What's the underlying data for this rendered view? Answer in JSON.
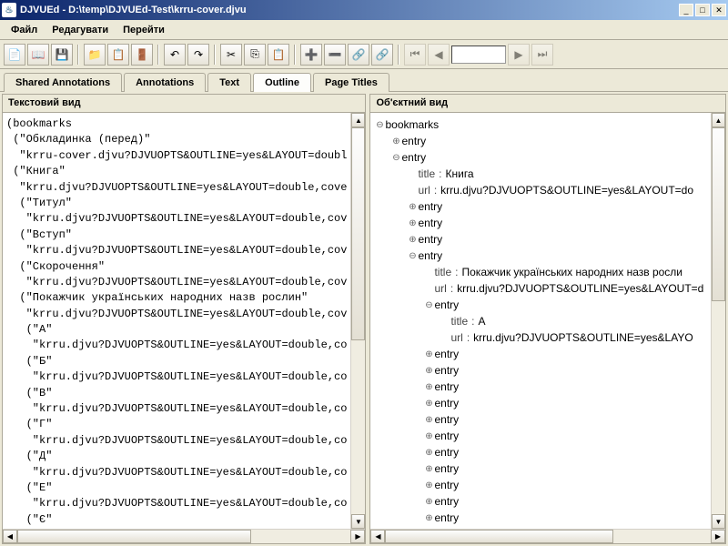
{
  "title": "DJVUEd - D:\\temp\\DJVUEd-Test\\krru-cover.djvu",
  "menu": {
    "file": "Файл",
    "edit": "Редагувати",
    "go": "Перейти"
  },
  "tabs": {
    "shared": "Shared Annotations",
    "annotations": "Annotations",
    "text": "Text",
    "outline": "Outline",
    "pagetitles": "Page Titles"
  },
  "panes": {
    "text": "Текстовий вид",
    "object": "Об'єктний вид"
  },
  "textview": "(bookmarks\n (\"Обкладинка (перед)\"\n  \"krru-cover.djvu?DJVUOPTS&OUTLINE=yes&LAYOUT=doubl\n (\"Книга\"\n  \"krru.djvu?DJVUOPTS&OUTLINE=yes&LAYOUT=double,cove\n  (\"Титул\"\n   \"krru.djvu?DJVUOPTS&OUTLINE=yes&LAYOUT=double,cov\n  (\"Вступ\"\n   \"krru.djvu?DJVUOPTS&OUTLINE=yes&LAYOUT=double,cov\n  (\"Скорочення\"\n   \"krru.djvu?DJVUOPTS&OUTLINE=yes&LAYOUT=double,cov\n  (\"Покажчик українських народних назв рослин\"\n   \"krru.djvu?DJVUOPTS&OUTLINE=yes&LAYOUT=double,cov\n   (\"А\"\n    \"krru.djvu?DJVUOPTS&OUTLINE=yes&LAYOUT=double,co\n   (\"Б\"\n    \"krru.djvu?DJVUOPTS&OUTLINE=yes&LAYOUT=double,co\n   (\"В\"\n    \"krru.djvu?DJVUOPTS&OUTLINE=yes&LAYOUT=double,co\n   (\"Г\"\n    \"krru.djvu?DJVUOPTS&OUTLINE=yes&LAYOUT=double,co\n   (\"Д\"\n    \"krru.djvu?DJVUOPTS&OUTLINE=yes&LAYOUT=double,co\n   (\"Е\"\n    \"krru.djvu?DJVUOPTS&OUTLINE=yes&LAYOUT=double,co\n   (\"Є\"",
  "tree": {
    "root": "bookmarks",
    "entry": "entry",
    "title_key": "title",
    "url_key": "url",
    "n1_title": "Книга",
    "n1_url": "krru.djvu?DJVUOPTS&OUTLINE=yes&LAYOUT=do",
    "n4_title": "Покажчик українських народних назв росли",
    "n4_url": "krru.djvu?DJVUOPTS&OUTLINE=yes&LAYOUT=d",
    "n4a_title": "А",
    "n4a_url": "krru.djvu?DJVUOPTS&OUTLINE=yes&LAYO"
  }
}
